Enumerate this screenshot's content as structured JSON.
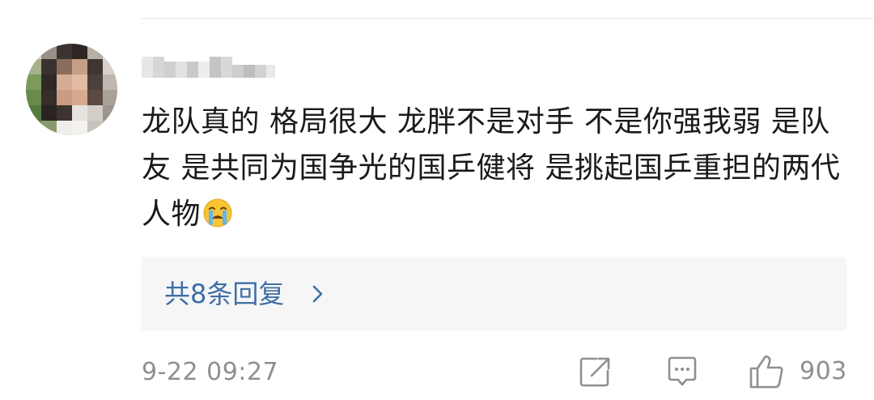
{
  "comment": {
    "text": "龙队真的 格局很大 龙胖不是对手 不是你强我弱 是队友 是共同为国争光的国乒健将 是挑起国乒重担的两代人物",
    "emoji": "crying-face-emoji"
  },
  "replies": {
    "label": "共8条回复"
  },
  "meta": {
    "timestamp": "9-22 09:27",
    "like_count": "903"
  },
  "icons": {
    "share": "share-icon",
    "reply": "comment-icon",
    "like": "thumbs-up-icon",
    "chevron": "chevron-right-icon"
  },
  "colors": {
    "text": "#1a1a1a",
    "link": "#3f6ea6",
    "meta": "#8f8f8f",
    "reply_box_bg": "#f6f6f6"
  }
}
